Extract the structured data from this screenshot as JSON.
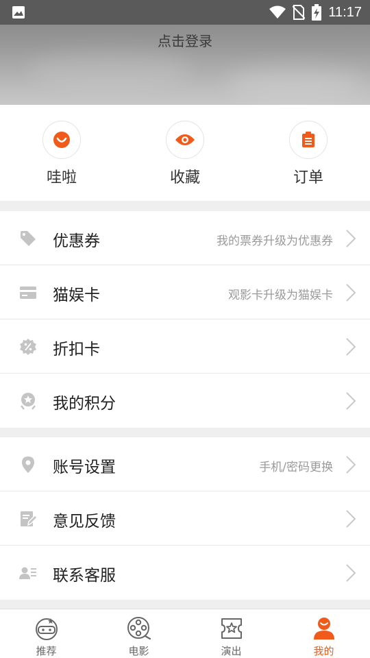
{
  "status_bar": {
    "time": "11:17"
  },
  "header": {
    "login_text": "点击登录"
  },
  "quick_actions": [
    {
      "label": "哇啦",
      "icon": "smile-face-icon"
    },
    {
      "label": "收藏",
      "icon": "eye-icon"
    },
    {
      "label": "订单",
      "icon": "clipboard-icon"
    }
  ],
  "menu_group_1": [
    {
      "label": "优惠券",
      "hint": "我的票券升级为优惠券",
      "icon": "tag-icon"
    },
    {
      "label": "猫娱卡",
      "hint": "观影卡升级为猫娱卡",
      "icon": "card-icon"
    },
    {
      "label": "折扣卡",
      "hint": "",
      "icon": "percent-badge-icon"
    },
    {
      "label": "我的积分",
      "hint": "",
      "icon": "medal-icon"
    }
  ],
  "menu_group_2": [
    {
      "label": "账号设置",
      "hint": "手机/密码更换",
      "icon": "location-pin-icon"
    },
    {
      "label": "意见反馈",
      "hint": "",
      "icon": "feedback-edit-icon"
    },
    {
      "label": "联系客服",
      "hint": "",
      "icon": "contact-card-icon"
    }
  ],
  "bottom_nav": [
    {
      "label": "推荐",
      "icon": "mascot-icon",
      "active": false
    },
    {
      "label": "电影",
      "icon": "film-reel-icon",
      "active": false
    },
    {
      "label": "演出",
      "icon": "ticket-star-icon",
      "active": false
    },
    {
      "label": "我的",
      "icon": "person-icon",
      "active": true
    }
  ],
  "colors": {
    "accent": "#f05a1a",
    "icon_gray": "#c4c4c4",
    "hint_gray": "#9a9a9a"
  }
}
